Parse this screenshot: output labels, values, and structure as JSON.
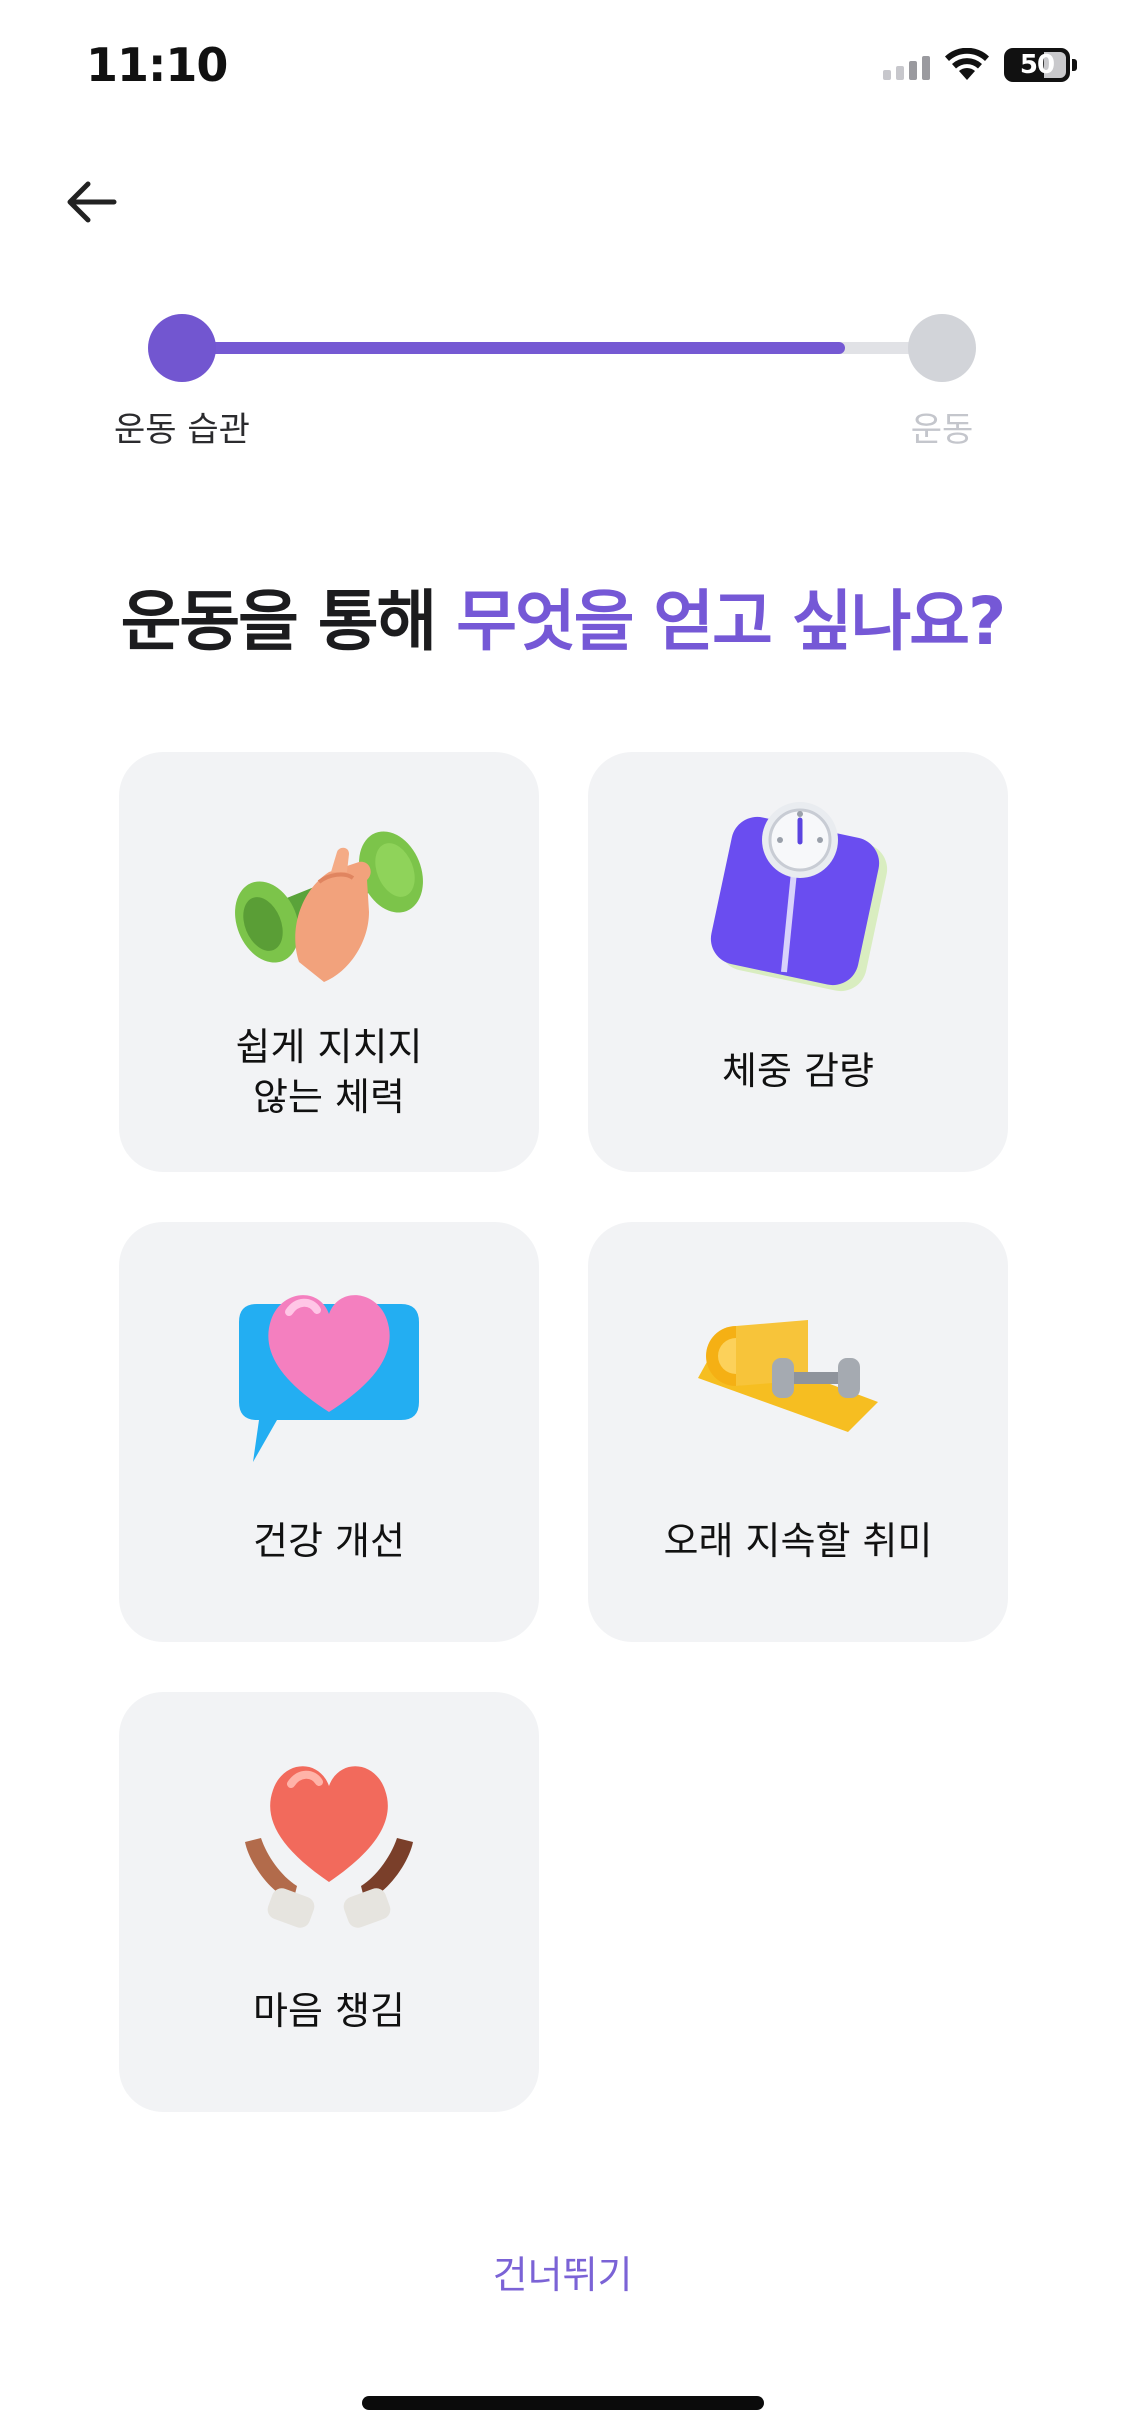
{
  "status_bar": {
    "time": "11:10",
    "battery": "50",
    "icons": [
      "signal-icon",
      "wifi-icon",
      "battery-icon"
    ]
  },
  "nav": {
    "back_icon": "arrow-left-icon"
  },
  "progress": {
    "start_label": "운동 습관",
    "end_label": "운동",
    "fraction": 0.85,
    "accent_color": "#7256d0",
    "inactive_color": "#d2d4d9"
  },
  "headline": {
    "part1": "운동을 통해 ",
    "part2": "무엇을 얻고 싶나요?"
  },
  "options": [
    {
      "label": "쉽게 지치지\n않는 체력",
      "icon": "dumbbell-hand-icon"
    },
    {
      "label": "체중 감량",
      "icon": "scale-icon"
    },
    {
      "label": "건강 개선",
      "icon": "heart-chat-icon"
    },
    {
      "label": "오래 지속할 취미",
      "icon": "yoga-mat-dumbbell-icon"
    },
    {
      "label": "마음 챙김",
      "icon": "heart-hands-icon"
    }
  ],
  "skip_label": "건너뛰기"
}
